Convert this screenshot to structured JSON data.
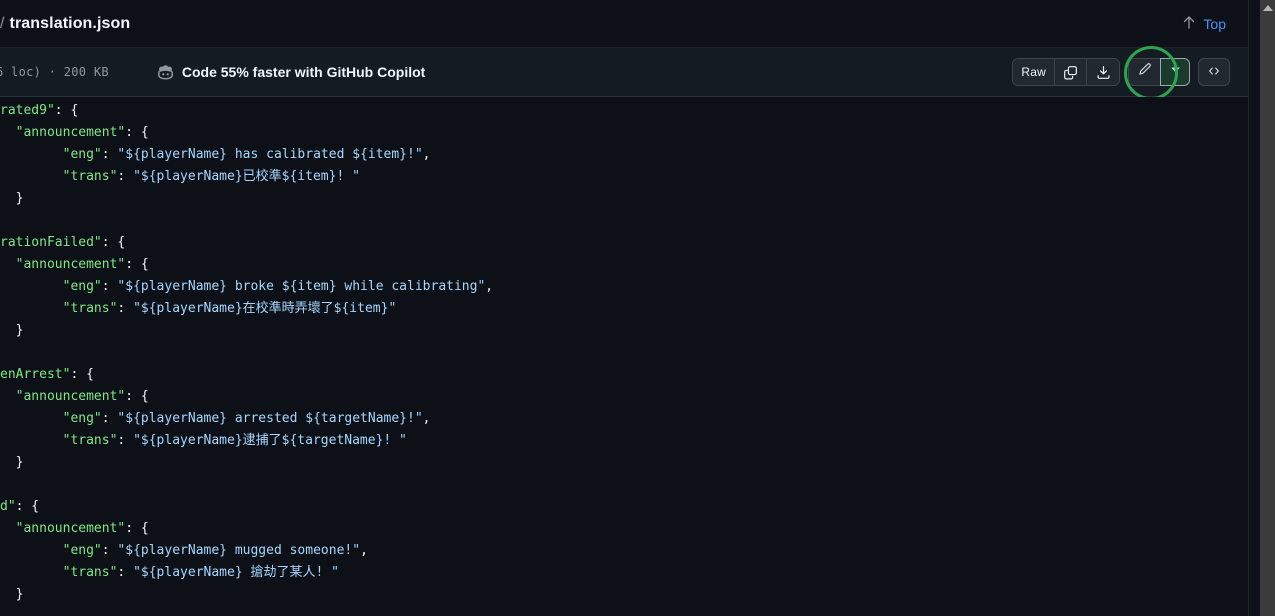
{
  "header": {
    "breadcrumb_separator": "/",
    "file_name": "translation.json",
    "top_label": "Top",
    "up_arrow": "↑"
  },
  "toolbar": {
    "file_meta": "6 loc)  ·  200 KB",
    "copilot_banner": "Code 55% faster with GitHub Copilot",
    "raw_label": "Raw",
    "icons": {
      "copilot": "copilot-icon",
      "copy": "copy-icon",
      "download": "download-icon",
      "edit": "pencil-icon",
      "caret": "chevron-down-icon",
      "symbols": "code-symbols-icon"
    },
    "highlight_color": "#2da44e"
  },
  "colors": {
    "background": "#0d1117",
    "toolbar_background": "#151b23",
    "border": "#3d444d",
    "key": "#7ee787",
    "string": "#a5d6ff",
    "punctuation": "#f0f6fc",
    "link": "#4493f8",
    "muted": "#9198a1"
  },
  "code": {
    "language": "json",
    "lines": [
      [
        {
          "t": "k",
          "v": "rated9\""
        },
        {
          "t": "p",
          "v": ": {"
        }
      ],
      [
        {
          "t": "p",
          "v": "  "
        },
        {
          "t": "k",
          "v": "\"announcement\""
        },
        {
          "t": "p",
          "v": ": {"
        }
      ],
      [
        {
          "t": "p",
          "v": "        "
        },
        {
          "t": "k",
          "v": "\"eng\""
        },
        {
          "t": "p",
          "v": ": "
        },
        {
          "t": "s",
          "v": "\"${playerName} has calibrated ${item}!\""
        },
        {
          "t": "p",
          "v": ","
        }
      ],
      [
        {
          "t": "p",
          "v": "        "
        },
        {
          "t": "k",
          "v": "\"trans\""
        },
        {
          "t": "p",
          "v": ": "
        },
        {
          "t": "s",
          "v": "\"${playerName}已校準${item}! \""
        }
      ],
      [
        {
          "t": "p",
          "v": "  }"
        }
      ],
      [
        {
          "t": "p",
          "v": ""
        }
      ],
      [
        {
          "t": "k",
          "v": "rationFailed\""
        },
        {
          "t": "p",
          "v": ": {"
        }
      ],
      [
        {
          "t": "p",
          "v": "  "
        },
        {
          "t": "k",
          "v": "\"announcement\""
        },
        {
          "t": "p",
          "v": ": {"
        }
      ],
      [
        {
          "t": "p",
          "v": "        "
        },
        {
          "t": "k",
          "v": "\"eng\""
        },
        {
          "t": "p",
          "v": ": "
        },
        {
          "t": "s",
          "v": "\"${playerName} broke ${item} while calibrating\""
        },
        {
          "t": "p",
          "v": ","
        }
      ],
      [
        {
          "t": "p",
          "v": "        "
        },
        {
          "t": "k",
          "v": "\"trans\""
        },
        {
          "t": "p",
          "v": ": "
        },
        {
          "t": "s",
          "v": "\"${playerName}在校準時弄壞了${item}\""
        }
      ],
      [
        {
          "t": "p",
          "v": "  }"
        }
      ],
      [
        {
          "t": "p",
          "v": ""
        }
      ],
      [
        {
          "t": "k",
          "v": "enArrest\""
        },
        {
          "t": "p",
          "v": ": {"
        }
      ],
      [
        {
          "t": "p",
          "v": "  "
        },
        {
          "t": "k",
          "v": "\"announcement\""
        },
        {
          "t": "p",
          "v": ": {"
        }
      ],
      [
        {
          "t": "p",
          "v": "        "
        },
        {
          "t": "k",
          "v": "\"eng\""
        },
        {
          "t": "p",
          "v": ": "
        },
        {
          "t": "s",
          "v": "\"${playerName} arrested ${targetName}!\""
        },
        {
          "t": "p",
          "v": ","
        }
      ],
      [
        {
          "t": "p",
          "v": "        "
        },
        {
          "t": "k",
          "v": "\"trans\""
        },
        {
          "t": "p",
          "v": ": "
        },
        {
          "t": "s",
          "v": "\"${playerName}逮捕了${targetName}! \""
        }
      ],
      [
        {
          "t": "p",
          "v": "  }"
        }
      ],
      [
        {
          "t": "p",
          "v": ""
        }
      ],
      [
        {
          "t": "k",
          "v": "d\""
        },
        {
          "t": "p",
          "v": ": {"
        }
      ],
      [
        {
          "t": "p",
          "v": "  "
        },
        {
          "t": "k",
          "v": "\"announcement\""
        },
        {
          "t": "p",
          "v": ": {"
        }
      ],
      [
        {
          "t": "p",
          "v": "        "
        },
        {
          "t": "k",
          "v": "\"eng\""
        },
        {
          "t": "p",
          "v": ": "
        },
        {
          "t": "s",
          "v": "\"${playerName} mugged someone!\""
        },
        {
          "t": "p",
          "v": ","
        }
      ],
      [
        {
          "t": "p",
          "v": "        "
        },
        {
          "t": "k",
          "v": "\"trans\""
        },
        {
          "t": "p",
          "v": ": "
        },
        {
          "t": "s",
          "v": "\"${playerName} 搶劫了某人! \""
        }
      ],
      [
        {
          "t": "p",
          "v": "  }"
        }
      ]
    ]
  },
  "scrollbar": {
    "up_arrow": "▲"
  }
}
